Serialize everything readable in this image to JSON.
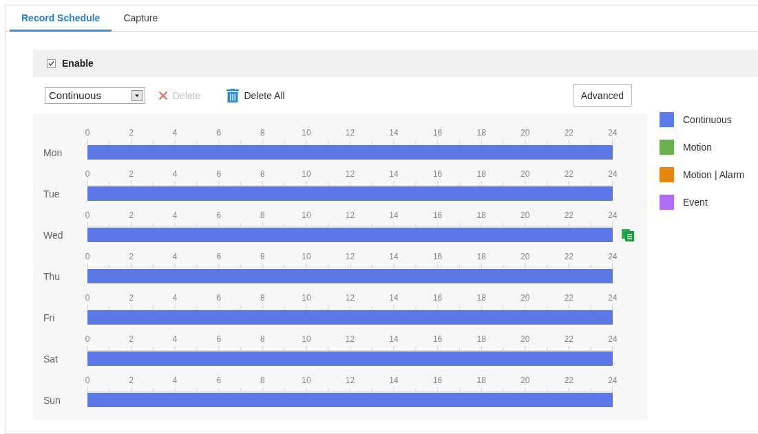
{
  "tabs": [
    {
      "label": "Record Schedule",
      "selected": true
    },
    {
      "label": "Capture",
      "selected": false
    }
  ],
  "enable": {
    "label": "Enable",
    "checked": true
  },
  "toolbar": {
    "record_type": {
      "value": "Continuous"
    },
    "delete_button": {
      "label": "Delete",
      "disabled": true
    },
    "delete_all_button": {
      "label": "Delete All",
      "disabled": false
    },
    "advanced_button": {
      "label": "Advanced"
    }
  },
  "schedule": {
    "days": [
      {
        "name": "Mon",
        "selected": false,
        "ticks": [
          "0",
          "2",
          "4",
          "6",
          "8",
          "10",
          "12",
          "14",
          "16",
          "18",
          "20",
          "22",
          "24"
        ],
        "segment": {
          "color": "#5b78e6"
        }
      },
      {
        "name": "Tue",
        "selected": false,
        "ticks": [
          "0",
          "2",
          "4",
          "6",
          "8",
          "10",
          "12",
          "14",
          "16",
          "18",
          "20",
          "22",
          "24"
        ],
        "segment": {
          "color": "#5b78e6"
        }
      },
      {
        "name": "Wed",
        "selected": true,
        "ticks": [
          "0",
          "2",
          "4",
          "6",
          "8",
          "10",
          "12",
          "14",
          "16",
          "18",
          "20",
          "22",
          "24"
        ],
        "segment": {
          "color": "#5b78e6"
        }
      },
      {
        "name": "Thu",
        "selected": false,
        "ticks": [
          "0",
          "2",
          "4",
          "6",
          "8",
          "10",
          "12",
          "14",
          "16",
          "18",
          "20",
          "22",
          "24"
        ],
        "segment": {
          "color": "#5b78e6"
        }
      },
      {
        "name": "Fri",
        "selected": false,
        "ticks": [
          "0",
          "2",
          "4",
          "6",
          "8",
          "10",
          "12",
          "14",
          "16",
          "18",
          "20",
          "22",
          "24"
        ],
        "segment": {
          "color": "#5b78e6"
        }
      },
      {
        "name": "Sat",
        "selected": false,
        "ticks": [
          "0",
          "2",
          "4",
          "6",
          "8",
          "10",
          "12",
          "14",
          "16",
          "18",
          "20",
          "22",
          "24"
        ],
        "segment": {
          "color": "#5b78e6"
        }
      },
      {
        "name": "Sun",
        "selected": false,
        "ticks": [
          "0",
          "2",
          "4",
          "6",
          "8",
          "10",
          "12",
          "14",
          "16",
          "18",
          "20",
          "22",
          "24"
        ],
        "segment": {
          "color": "#5b78e6"
        }
      }
    ]
  },
  "legend": [
    {
      "label": "Continuous",
      "color": "#5b7be6"
    },
    {
      "label": "Motion",
      "color": "#6ab04c"
    },
    {
      "label": "Motion | Alarm",
      "color": "#e8850e"
    },
    {
      "label": "Event",
      "color": "#b06cf2"
    }
  ]
}
